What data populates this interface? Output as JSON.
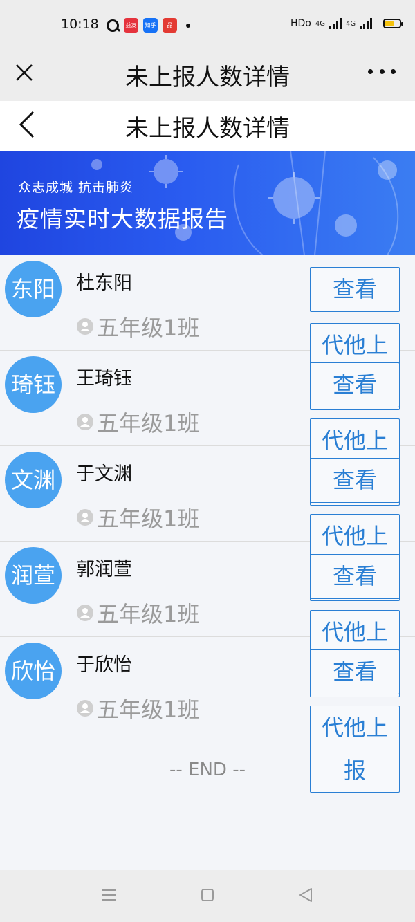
{
  "status_bar": {
    "time": "10:18",
    "app_icons": [
      "qq-browser-icon",
      "red-app-icon",
      "zhihu-icon",
      "red-app-2-icon"
    ],
    "app_labels": [
      "益友",
      "知乎",
      "品"
    ],
    "hd_text": "HDo",
    "network_1": "4G",
    "network_2": "4G",
    "battery_percent": 60,
    "battery_color": "#f4c20d"
  },
  "top_bar": {
    "title": "未上报人数详情"
  },
  "page_header": {
    "title": "未上报人数详情"
  },
  "banner": {
    "subtitle": "众志成城  抗击肺炎",
    "title": "疫情实时大数据报告"
  },
  "colors": {
    "avatar": "#4aa3f0",
    "button_border": "#2a7fd4",
    "banner_start": "#1f45e0",
    "banner_end": "#3b7df2"
  },
  "students": [
    {
      "avatar": "东阳",
      "name": "杜东阳",
      "class": "五年级1班"
    },
    {
      "avatar": "琦钰",
      "name": "王琦钰",
      "class": "五年级1班"
    },
    {
      "avatar": "文渊",
      "name": "于文渊",
      "class": "五年级1班"
    },
    {
      "avatar": "润萱",
      "name": "郭润萱",
      "class": "五年级1班"
    },
    {
      "avatar": "欣怡",
      "name": "于欣怡",
      "class": "五年级1班"
    }
  ],
  "buttons": {
    "view": "查看",
    "report": "代他上报"
  },
  "end_text": "-- END --"
}
